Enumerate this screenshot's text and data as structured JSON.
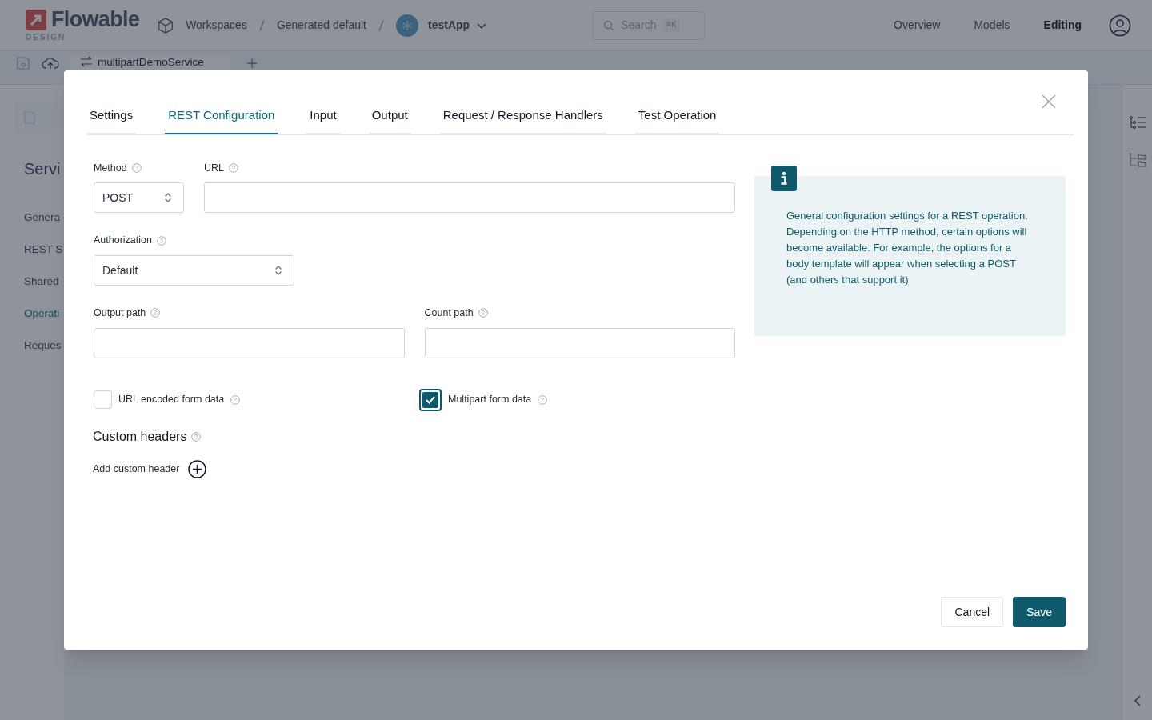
{
  "header": {
    "brand": "Flowable",
    "brand_sub": "DESIGN",
    "breadcrumbs": [
      "Workspaces",
      "Generated default"
    ],
    "app": "testApp",
    "search": {
      "placeholder": "Search",
      "shortcut": "⌘K"
    },
    "nav": [
      {
        "label": "Overview",
        "selected": false
      },
      {
        "label": "Models",
        "selected": false
      },
      {
        "label": "Editing",
        "selected": true
      }
    ]
  },
  "editor_tab": "multipartDemoService",
  "side_panel": {
    "title": "Servi",
    "items": [
      {
        "label": "Genera",
        "selected": false
      },
      {
        "label": "REST S",
        "selected": false
      },
      {
        "label": "Shared",
        "selected": false
      },
      {
        "label": "Operati",
        "selected": true
      },
      {
        "label": "Reques",
        "selected": false
      }
    ]
  },
  "dialog": {
    "tabs": [
      {
        "label": "Settings",
        "selected": false
      },
      {
        "label": "REST Configuration",
        "selected": true
      },
      {
        "label": "Input",
        "selected": false
      },
      {
        "label": "Output",
        "selected": false
      },
      {
        "label": "Request / Response Handlers",
        "selected": false
      },
      {
        "label": "Test Operation",
        "selected": false
      }
    ],
    "method": {
      "label": "Method",
      "value": "POST"
    },
    "url": {
      "label": "URL"
    },
    "authorization": {
      "label": "Authorization",
      "value": "Default"
    },
    "output_path": {
      "label": "Output path"
    },
    "count_path": {
      "label": "Count path"
    },
    "checkboxes": [
      {
        "label": "URL encoded form data",
        "checked": false
      },
      {
        "label": "Multipart form data",
        "checked": true
      }
    ],
    "custom_headers": {
      "title": "Custom headers",
      "add_label": "Add custom header"
    },
    "info": "General configuration settings for a REST operation. Depending on the HTTP method, certain options will become available. For example, the options for a body template will appear when selecting a POST (and others that support it)",
    "buttons": [
      {
        "label": "Cancel",
        "kind": "secondary"
      },
      {
        "label": "Save",
        "kind": "primary"
      }
    ]
  }
}
